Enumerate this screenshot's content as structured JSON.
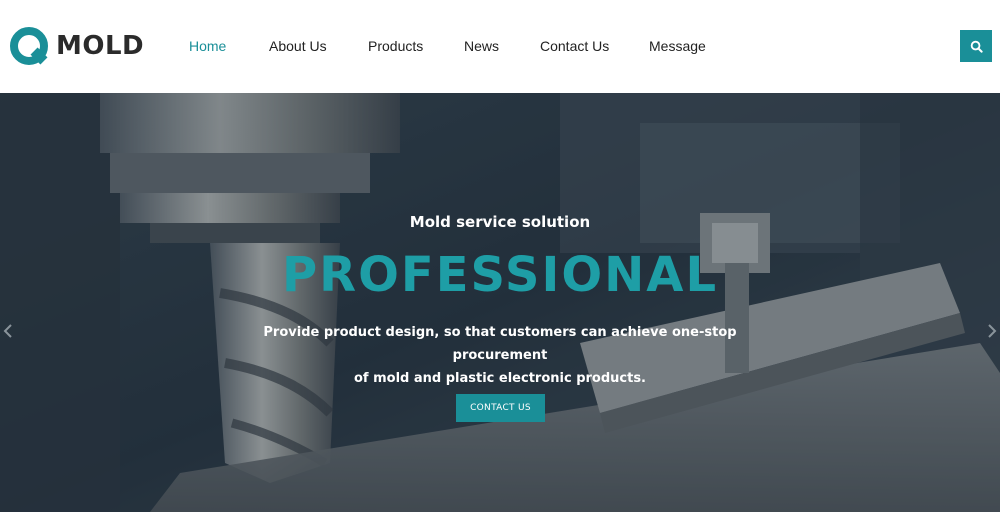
{
  "brand": {
    "name": "MOLD",
    "accent": "#1a8f98"
  },
  "nav": {
    "items": [
      {
        "label": "Home",
        "active": true
      },
      {
        "label": "About Us",
        "active": false
      },
      {
        "label": "Products",
        "active": false
      },
      {
        "label": "News",
        "active": false
      },
      {
        "label": "Contact Us",
        "active": false
      },
      {
        "label": "Message",
        "active": false
      }
    ],
    "search_icon": "search-icon"
  },
  "hero": {
    "subtitle": "Mold service solution",
    "title": "PROFESSIONAL",
    "description_line1": "Provide product design, so that customers can achieve one-stop procurement",
    "description_line2": "of mold and plastic electronic products.",
    "cta_label": "CONTACT US",
    "prev_icon": "chevron-left-icon",
    "next_icon": "chevron-right-icon"
  }
}
